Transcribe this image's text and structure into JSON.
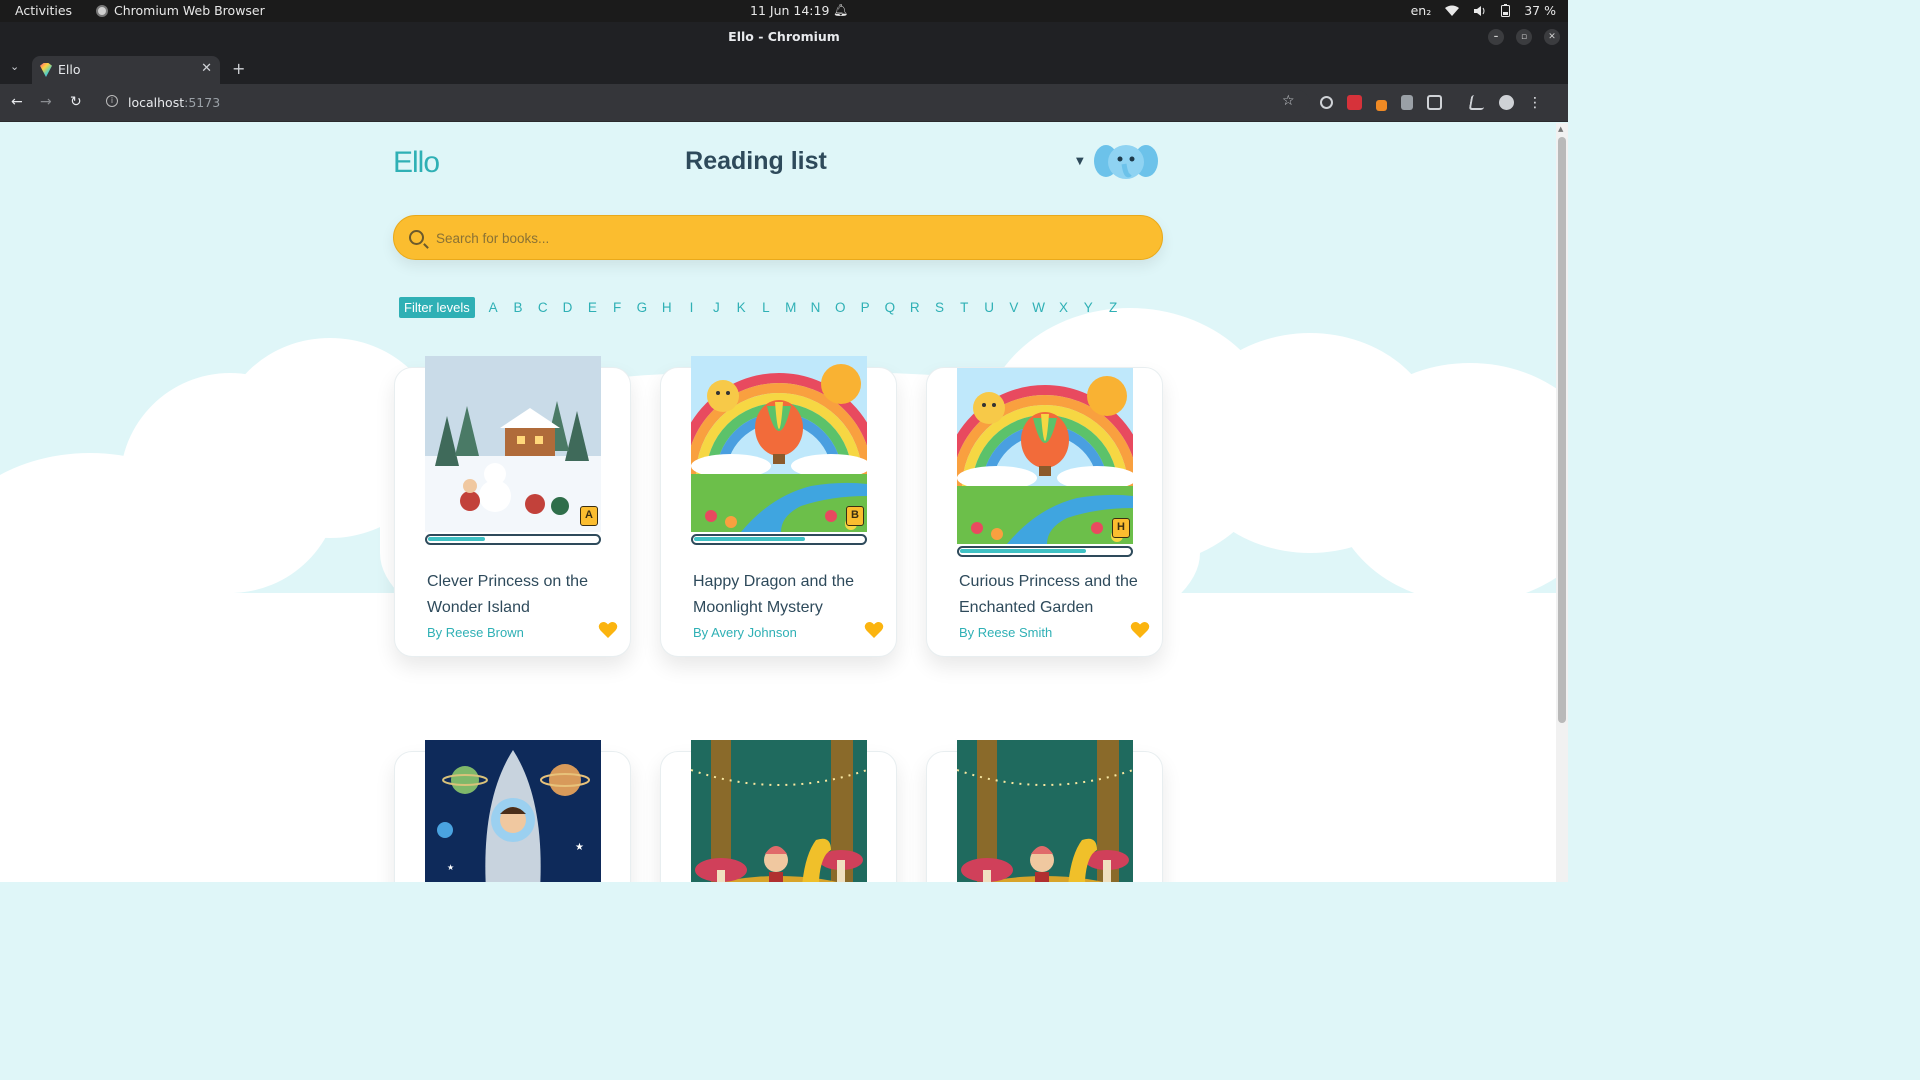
{
  "os": {
    "activities": "Activities",
    "app_name": "Chromium Web Browser",
    "datetime": "11 Jun  14:19",
    "input_lang": "en₂",
    "battery": "37 %"
  },
  "browser": {
    "window_title": "Ello - Chromium",
    "tab_title": "Ello",
    "url_host": "localhost",
    "url_port": ":5173"
  },
  "app": {
    "logo": "Ello",
    "page_title": "Reading list",
    "search_placeholder": "Search for books...",
    "filter_label": "Filter levels",
    "levels": [
      "A",
      "B",
      "C",
      "D",
      "E",
      "F",
      "G",
      "H",
      "I",
      "J",
      "K",
      "L",
      "M",
      "N",
      "O",
      "P",
      "Q",
      "R",
      "S",
      "T",
      "U",
      "V",
      "W",
      "X",
      "Y",
      "Z"
    ]
  },
  "books": [
    {
      "title": "Clever Princess on the Wonder Island",
      "author": "By Reese Brown",
      "level": "A",
      "progress": 0.34,
      "favorite": true,
      "cover": "winter-snowman"
    },
    {
      "title": "Happy Dragon and the Moonlight Mystery",
      "author": "By Avery Johnson",
      "level": "B",
      "progress": 0.66,
      "favorite": true,
      "cover": "rainbow-balloon"
    },
    {
      "title": "Curious Princess and the Enchanted Garden",
      "author": "By Reese Smith",
      "level": "H",
      "progress": 0.75,
      "favorite": true,
      "cover": "rainbow-balloon"
    },
    {
      "cover": "space-astronaut"
    },
    {
      "cover": "forest-dragon"
    },
    {
      "cover": "forest-dragon"
    }
  ],
  "colors": {
    "accent": "#2fb0b5",
    "search_bg": "#fbbd2f",
    "heart": "#fbb40f",
    "text": "#2e4a5b"
  }
}
